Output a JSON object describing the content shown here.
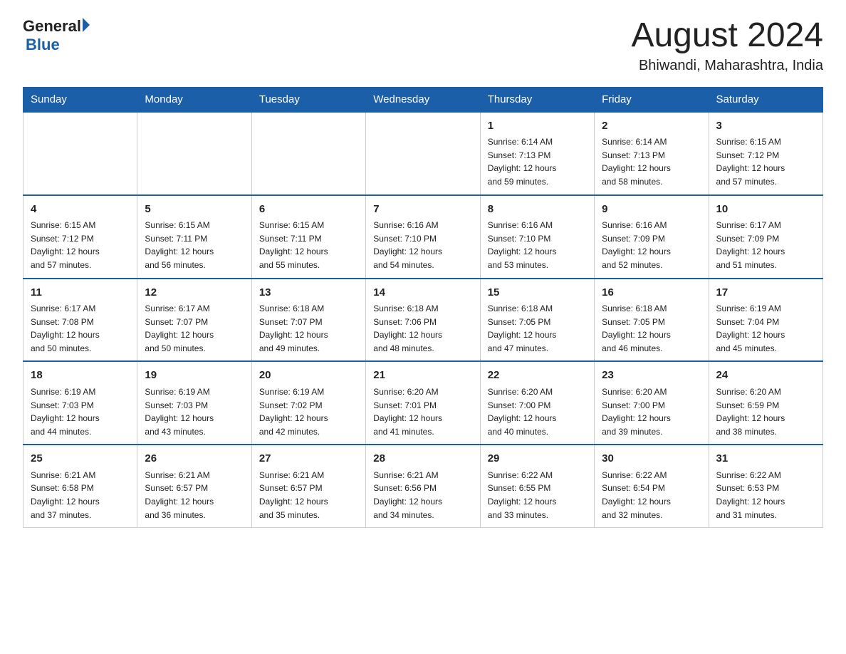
{
  "header": {
    "logo_general": "General",
    "logo_blue": "Blue",
    "month_title": "August 2024",
    "location": "Bhiwandi, Maharashtra, India"
  },
  "days_of_week": [
    "Sunday",
    "Monday",
    "Tuesday",
    "Wednesday",
    "Thursday",
    "Friday",
    "Saturday"
  ],
  "weeks": [
    [
      {
        "day": "",
        "info": ""
      },
      {
        "day": "",
        "info": ""
      },
      {
        "day": "",
        "info": ""
      },
      {
        "day": "",
        "info": ""
      },
      {
        "day": "1",
        "info": "Sunrise: 6:14 AM\nSunset: 7:13 PM\nDaylight: 12 hours\nand 59 minutes."
      },
      {
        "day": "2",
        "info": "Sunrise: 6:14 AM\nSunset: 7:13 PM\nDaylight: 12 hours\nand 58 minutes."
      },
      {
        "day": "3",
        "info": "Sunrise: 6:15 AM\nSunset: 7:12 PM\nDaylight: 12 hours\nand 57 minutes."
      }
    ],
    [
      {
        "day": "4",
        "info": "Sunrise: 6:15 AM\nSunset: 7:12 PM\nDaylight: 12 hours\nand 57 minutes."
      },
      {
        "day": "5",
        "info": "Sunrise: 6:15 AM\nSunset: 7:11 PM\nDaylight: 12 hours\nand 56 minutes."
      },
      {
        "day": "6",
        "info": "Sunrise: 6:15 AM\nSunset: 7:11 PM\nDaylight: 12 hours\nand 55 minutes."
      },
      {
        "day": "7",
        "info": "Sunrise: 6:16 AM\nSunset: 7:10 PM\nDaylight: 12 hours\nand 54 minutes."
      },
      {
        "day": "8",
        "info": "Sunrise: 6:16 AM\nSunset: 7:10 PM\nDaylight: 12 hours\nand 53 minutes."
      },
      {
        "day": "9",
        "info": "Sunrise: 6:16 AM\nSunset: 7:09 PM\nDaylight: 12 hours\nand 52 minutes."
      },
      {
        "day": "10",
        "info": "Sunrise: 6:17 AM\nSunset: 7:09 PM\nDaylight: 12 hours\nand 51 minutes."
      }
    ],
    [
      {
        "day": "11",
        "info": "Sunrise: 6:17 AM\nSunset: 7:08 PM\nDaylight: 12 hours\nand 50 minutes."
      },
      {
        "day": "12",
        "info": "Sunrise: 6:17 AM\nSunset: 7:07 PM\nDaylight: 12 hours\nand 50 minutes."
      },
      {
        "day": "13",
        "info": "Sunrise: 6:18 AM\nSunset: 7:07 PM\nDaylight: 12 hours\nand 49 minutes."
      },
      {
        "day": "14",
        "info": "Sunrise: 6:18 AM\nSunset: 7:06 PM\nDaylight: 12 hours\nand 48 minutes."
      },
      {
        "day": "15",
        "info": "Sunrise: 6:18 AM\nSunset: 7:05 PM\nDaylight: 12 hours\nand 47 minutes."
      },
      {
        "day": "16",
        "info": "Sunrise: 6:18 AM\nSunset: 7:05 PM\nDaylight: 12 hours\nand 46 minutes."
      },
      {
        "day": "17",
        "info": "Sunrise: 6:19 AM\nSunset: 7:04 PM\nDaylight: 12 hours\nand 45 minutes."
      }
    ],
    [
      {
        "day": "18",
        "info": "Sunrise: 6:19 AM\nSunset: 7:03 PM\nDaylight: 12 hours\nand 44 minutes."
      },
      {
        "day": "19",
        "info": "Sunrise: 6:19 AM\nSunset: 7:03 PM\nDaylight: 12 hours\nand 43 minutes."
      },
      {
        "day": "20",
        "info": "Sunrise: 6:19 AM\nSunset: 7:02 PM\nDaylight: 12 hours\nand 42 minutes."
      },
      {
        "day": "21",
        "info": "Sunrise: 6:20 AM\nSunset: 7:01 PM\nDaylight: 12 hours\nand 41 minutes."
      },
      {
        "day": "22",
        "info": "Sunrise: 6:20 AM\nSunset: 7:00 PM\nDaylight: 12 hours\nand 40 minutes."
      },
      {
        "day": "23",
        "info": "Sunrise: 6:20 AM\nSunset: 7:00 PM\nDaylight: 12 hours\nand 39 minutes."
      },
      {
        "day": "24",
        "info": "Sunrise: 6:20 AM\nSunset: 6:59 PM\nDaylight: 12 hours\nand 38 minutes."
      }
    ],
    [
      {
        "day": "25",
        "info": "Sunrise: 6:21 AM\nSunset: 6:58 PM\nDaylight: 12 hours\nand 37 minutes."
      },
      {
        "day": "26",
        "info": "Sunrise: 6:21 AM\nSunset: 6:57 PM\nDaylight: 12 hours\nand 36 minutes."
      },
      {
        "day": "27",
        "info": "Sunrise: 6:21 AM\nSunset: 6:57 PM\nDaylight: 12 hours\nand 35 minutes."
      },
      {
        "day": "28",
        "info": "Sunrise: 6:21 AM\nSunset: 6:56 PM\nDaylight: 12 hours\nand 34 minutes."
      },
      {
        "day": "29",
        "info": "Sunrise: 6:22 AM\nSunset: 6:55 PM\nDaylight: 12 hours\nand 33 minutes."
      },
      {
        "day": "30",
        "info": "Sunrise: 6:22 AM\nSunset: 6:54 PM\nDaylight: 12 hours\nand 32 minutes."
      },
      {
        "day": "31",
        "info": "Sunrise: 6:22 AM\nSunset: 6:53 PM\nDaylight: 12 hours\nand 31 minutes."
      }
    ]
  ]
}
